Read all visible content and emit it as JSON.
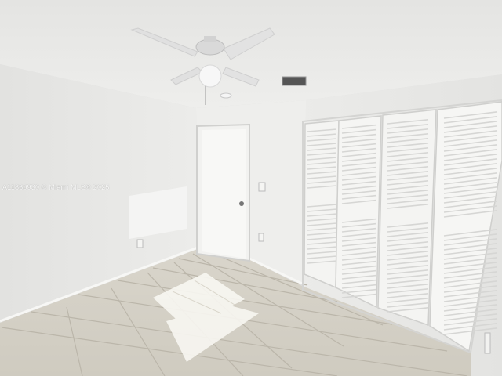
{
  "photo": {
    "watermark": "A11860930 © Miami MLS® 2025"
  },
  "colors": {
    "wall_left": "#e6e6e4",
    "wall_back": "#efefed",
    "wall_right": "#e9e9e7",
    "ceiling": "#e9e9e7",
    "floor_tile": "#d6d2c8",
    "grout": "#bdb8ad",
    "baseboard": "#f6f6f4",
    "fan_blade": "#e2e2e2",
    "closet_door": "#f4f4f2",
    "louver": "#dcdcda",
    "sunlight": "#f7f6f1"
  }
}
